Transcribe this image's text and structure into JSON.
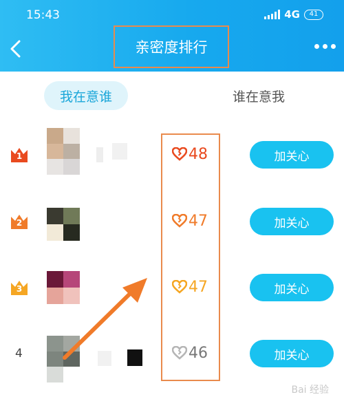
{
  "status_bar": {
    "time": "15:43",
    "network": "4G",
    "battery": "41"
  },
  "header": {
    "title": "亲密度排行"
  },
  "tabs": [
    {
      "label": "我在意谁",
      "active": true
    },
    {
      "label": "谁在意我",
      "active": false
    }
  ],
  "rows": [
    {
      "rank": "1",
      "score": "48",
      "button": "加关心",
      "badge_color": "#e94a1f",
      "heart_color": "#e94a1f"
    },
    {
      "rank": "2",
      "score": "47",
      "button": "加关心",
      "badge_color": "#f07b2a",
      "heart_color": "#f07b2a"
    },
    {
      "rank": "3",
      "score": "47",
      "button": "加关心",
      "badge_color": "#f5a623",
      "heart_color": "#f5a623"
    },
    {
      "rank": "4",
      "score": "46",
      "button": "加关心",
      "badge_color": "",
      "heart_color": "#b5b5b5"
    }
  ],
  "watermark": "Bai 经验",
  "colors": {
    "header": "#17a9ee",
    "button": "#19c2f0",
    "annotation": "#e98a4c",
    "arrow": "#f07b2a"
  }
}
